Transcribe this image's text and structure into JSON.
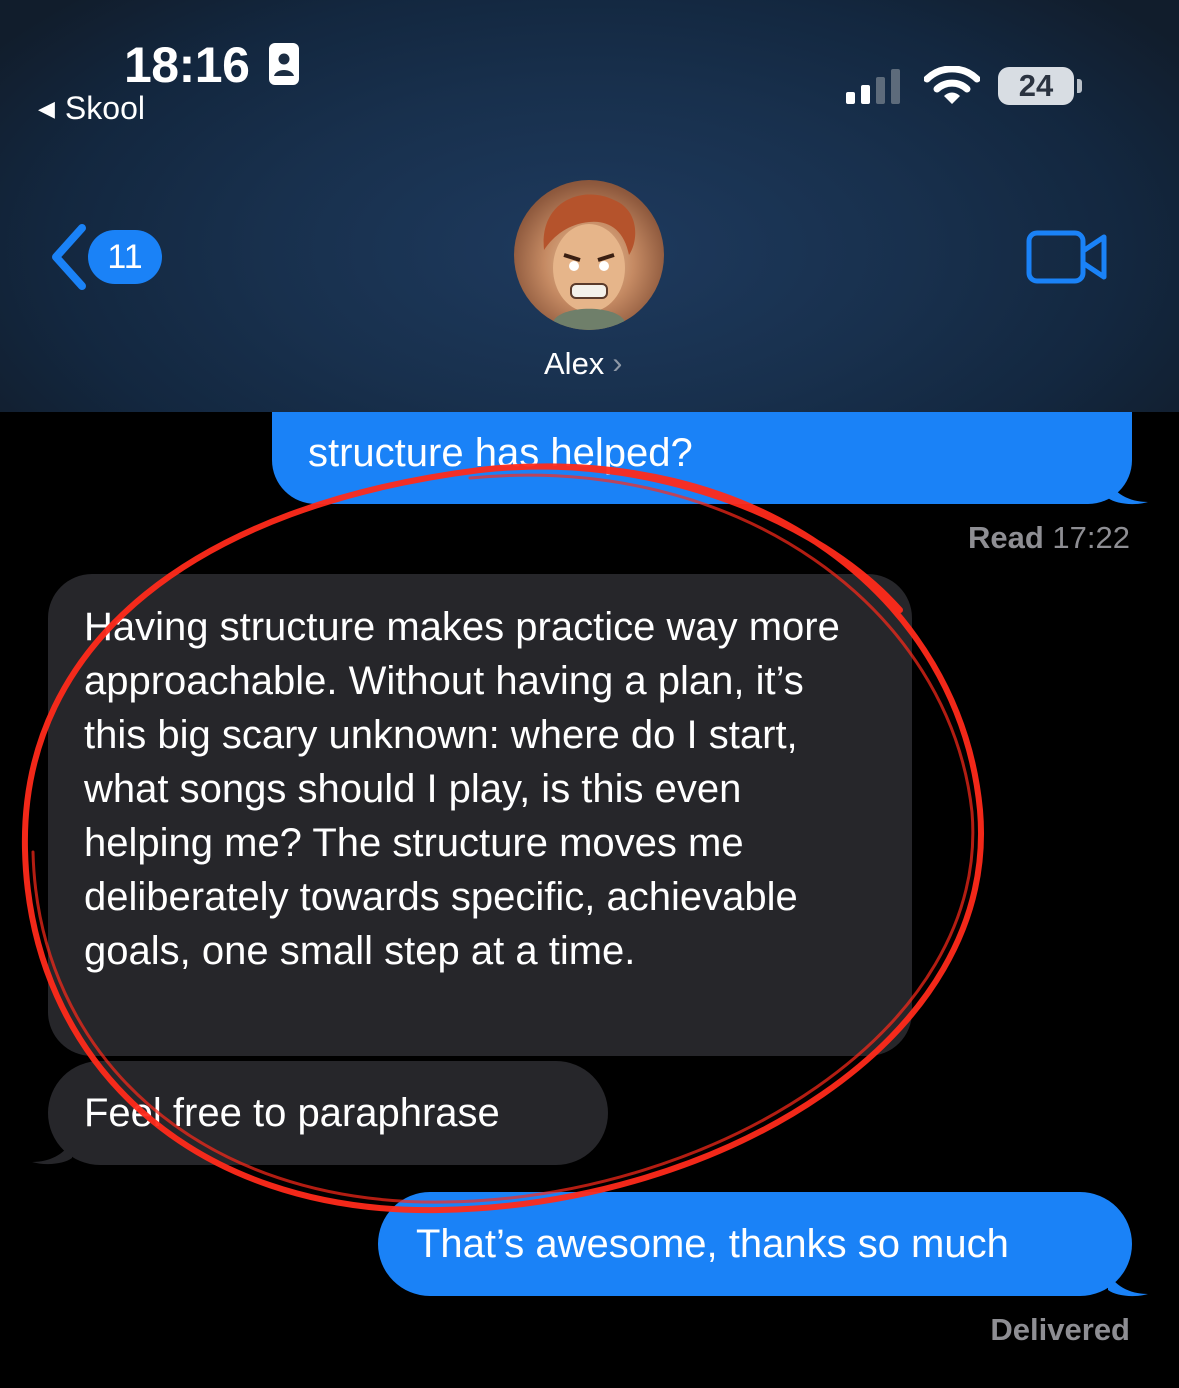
{
  "status_bar": {
    "time": "18:16",
    "back_app": "Skool",
    "battery": "24"
  },
  "nav": {
    "back_count": "11",
    "contact_name": "Alex"
  },
  "messages": [
    {
      "direction": "sent",
      "text": "structure has helped?"
    },
    {
      "direction": "received",
      "text": "Having structure makes practice way more approachable.  Without having a plan, it’s this big scary unknown: where do I start, what songs should I play, is this even helping me?  The structure moves me deliberately towards specific, achievable goals, one small step at a time."
    },
    {
      "direction": "received",
      "text": "Feel free to paraphrase"
    },
    {
      "direction": "sent",
      "text": "That’s awesome, thanks so much"
    }
  ],
  "read_receipt": {
    "label": "Read",
    "time": "17:22"
  },
  "delivered_label": "Delivered",
  "colors": {
    "sent_bubble": "#1a82f7",
    "received_bubble": "#26262a",
    "annotation": "#ff2a1a",
    "header": "#18304d"
  },
  "icons": [
    "id-card-icon",
    "back-triangle-icon",
    "signal-icon",
    "wifi-icon",
    "battery-icon",
    "back-chevron-icon",
    "video-camera-icon",
    "disclosure-chevron-icon"
  ]
}
